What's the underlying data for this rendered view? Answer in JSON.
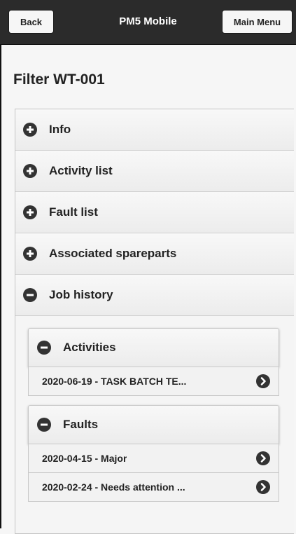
{
  "header": {
    "back_label": "Back",
    "title": "PM5 Mobile",
    "main_menu_label": "Main Menu"
  },
  "page": {
    "title": "Filter WT-001"
  },
  "sections": [
    {
      "label": "Info",
      "state": "collapsed",
      "icon": "plus-circle-icon"
    },
    {
      "label": "Activity list",
      "state": "collapsed",
      "icon": "plus-circle-icon"
    },
    {
      "label": "Fault list",
      "state": "collapsed",
      "icon": "plus-circle-icon"
    },
    {
      "label": "Associated spareparts",
      "state": "collapsed",
      "icon": "plus-circle-icon"
    },
    {
      "label": "Job history",
      "state": "expanded",
      "icon": "minus-circle-icon"
    }
  ],
  "job_history": {
    "activities": {
      "label": "Activities",
      "items": [
        "2020-06-19 - TASK BATCH TE..."
      ]
    },
    "faults": {
      "label": "Faults",
      "items": [
        "2020-04-15 - Major",
        "2020-02-24 - Needs attention ..."
      ]
    }
  },
  "colors": {
    "header_bg": "#2b2b2b",
    "icon_bg": "#333333",
    "page_bg": "#f6f6f6"
  }
}
